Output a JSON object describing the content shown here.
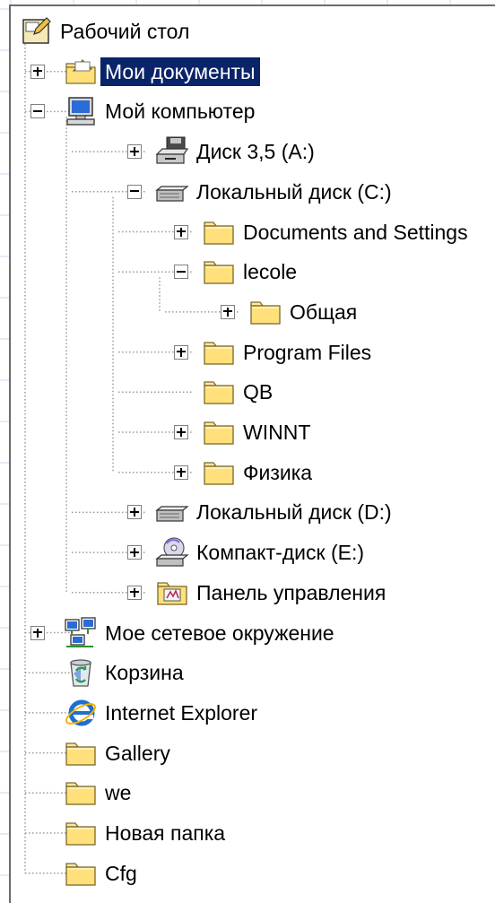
{
  "tree": [
    {
      "id": "desktop",
      "label": "Рабочий стол",
      "depth": 0,
      "expander": "none",
      "icon": "desktop-icon",
      "root": true
    },
    {
      "id": "my-documents",
      "label": "Мои документы",
      "depth": 1,
      "expander": "plus",
      "icon": "my-documents-icon",
      "selected": true
    },
    {
      "id": "my-computer",
      "label": "Мой компьютер",
      "depth": 1,
      "expander": "minus",
      "icon": "computer-icon"
    },
    {
      "id": "floppy",
      "label": "Диск 3,5 (A:)",
      "depth": 2,
      "expander": "plus",
      "icon": "floppy-drive-icon"
    },
    {
      "id": "drive-c",
      "label": "Локальный диск (C:)",
      "depth": 2,
      "expander": "minus",
      "icon": "hard-drive-icon"
    },
    {
      "id": "documents-and-settings",
      "label": "Documents and Settings",
      "depth": 3,
      "expander": "plus",
      "icon": "folder-icon"
    },
    {
      "id": "lecole",
      "label": "lecole",
      "depth": 3,
      "expander": "minus",
      "icon": "folder-icon"
    },
    {
      "id": "obshchaya",
      "label": "Общая",
      "depth": 4,
      "expander": "plus",
      "icon": "folder-icon"
    },
    {
      "id": "program-files",
      "label": "Program Files",
      "depth": 3,
      "expander": "plus",
      "icon": "folder-icon"
    },
    {
      "id": "qb",
      "label": "QB",
      "depth": 3,
      "expander": "none",
      "icon": "folder-icon"
    },
    {
      "id": "winnt",
      "label": "WINNT",
      "depth": 3,
      "expander": "plus",
      "icon": "folder-icon"
    },
    {
      "id": "fizika",
      "label": "Физика",
      "depth": 3,
      "expander": "plus",
      "icon": "folder-icon"
    },
    {
      "id": "drive-d",
      "label": "Локальный диск (D:)",
      "depth": 2,
      "expander": "plus",
      "icon": "hard-drive-icon"
    },
    {
      "id": "cd-drive-e",
      "label": "Компакт-диск (E:)",
      "depth": 2,
      "expander": "plus",
      "icon": "cd-drive-icon"
    },
    {
      "id": "control-panel",
      "label": "Панель управления",
      "depth": 2,
      "expander": "plus",
      "icon": "control-panel-icon"
    },
    {
      "id": "network",
      "label": "Мое сетевое окружение",
      "depth": 1,
      "expander": "plus",
      "icon": "network-places-icon"
    },
    {
      "id": "recycle-bin",
      "label": "Корзина",
      "depth": 1,
      "expander": "none",
      "icon": "recycle-bin-icon"
    },
    {
      "id": "internet-explorer",
      "label": "Internet Explorer",
      "depth": 1,
      "expander": "none",
      "icon": "internet-explorer-icon"
    },
    {
      "id": "gallery",
      "label": "Gallery",
      "depth": 1,
      "expander": "none",
      "icon": "folder-icon"
    },
    {
      "id": "we",
      "label": "we",
      "depth": 1,
      "expander": "none",
      "icon": "folder-icon"
    },
    {
      "id": "novaya-papka",
      "label": "Новая папка",
      "depth": 1,
      "expander": "none",
      "icon": "folder-icon"
    },
    {
      "id": "cfg",
      "label": "Cfg",
      "depth": 1,
      "expander": "none",
      "icon": "folder-icon"
    }
  ],
  "colors": {
    "selection_bg": "#0a246a",
    "selection_text": "#ffffff",
    "folder_fill": "#ffe07a",
    "tree_line": "#9a9a9a"
  }
}
